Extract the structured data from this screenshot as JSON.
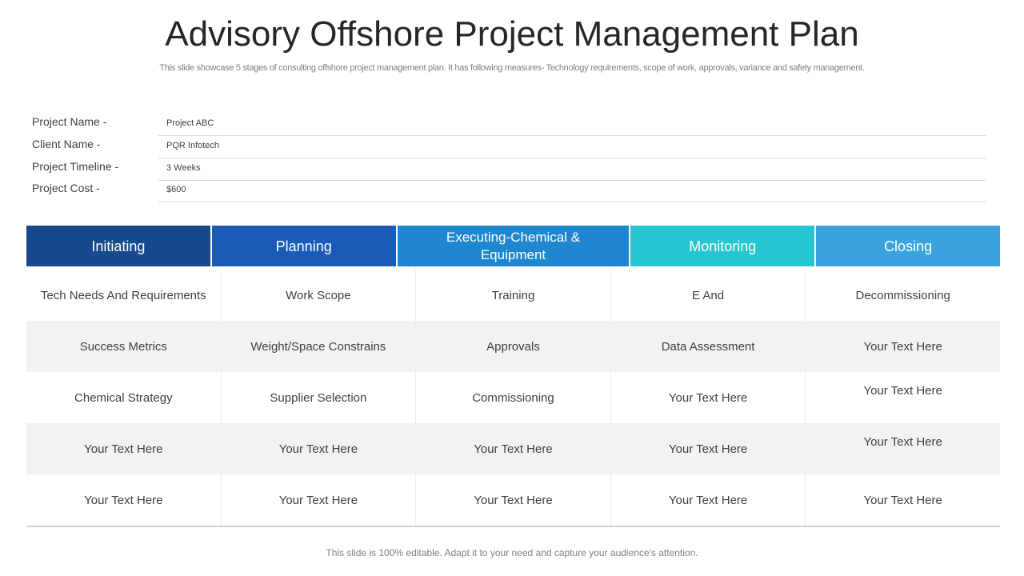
{
  "title": "Advisory Offshore Project Management Plan",
  "subtitle": "This slide showcase 5 stages of consulting offshore project management plan. It has following measures- Technology requirements, scope of work, approvals, variance and safety management.",
  "info": [
    {
      "label": "Project Name -",
      "value": "Project ABC"
    },
    {
      "label": "Client Name -",
      "value": "PQR Infotech"
    },
    {
      "label": "Project Timeline -",
      "value": "3 Weeks"
    },
    {
      "label": "Project Cost -",
      "value": "$600"
    }
  ],
  "columns": [
    {
      "label": "Initiating",
      "color": "#174a8c"
    },
    {
      "label": "Planning",
      "color": "#1a5bb5"
    },
    {
      "label": "Executing-Chemical & Equipment",
      "color": "#1f87cf"
    },
    {
      "label": "Monitoring",
      "color": "#26c6d0"
    },
    {
      "label": "Closing",
      "color": "#3aa3de"
    }
  ],
  "rows": [
    [
      "Tech Needs And Requirements",
      "Work Scope",
      "Training",
      "E And",
      "Decommissioning"
    ],
    [
      "Success Metrics",
      "Weight/Space Constrains",
      "Approvals",
      "Data Assessment",
      "Your Text Here"
    ],
    [
      "Chemical Strategy",
      "Supplier Selection",
      "Commissioning",
      "Your Text Here",
      "Your Text Here"
    ],
    [
      "Your Text Here",
      "Your Text Here",
      "Your Text Here",
      "Your Text Here",
      "Your Text Here"
    ],
    [
      "Your Text Here",
      "Your Text Here",
      "Your Text Here",
      "Your Text Here",
      "Your Text Here"
    ]
  ],
  "footer": "This slide is 100% editable. Adapt it to your need and capture your audience's attention."
}
